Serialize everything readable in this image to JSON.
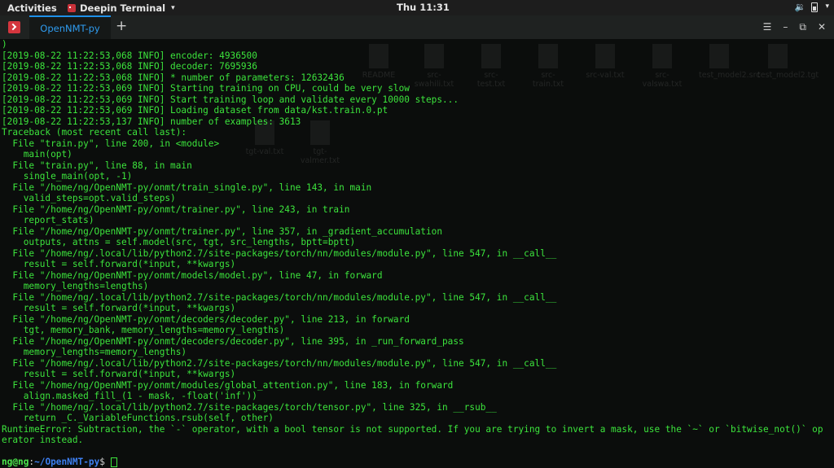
{
  "topbar": {
    "activities": "Activities",
    "app_name": "Deepin Terminal",
    "clock": "Thu 11:31"
  },
  "terminal": {
    "tab_label": "OpenNMT-py",
    "new_tab": "+",
    "lines": [
      ")",
      "[2019-08-22 11:22:53,068 INFO] encoder: 4936500",
      "[2019-08-22 11:22:53,068 INFO] decoder: 7695936",
      "[2019-08-22 11:22:53,068 INFO] * number of parameters: 12632436",
      "[2019-08-22 11:22:53,069 INFO] Starting training on CPU, could be very slow",
      "[2019-08-22 11:22:53,069 INFO] Start training loop and validate every 10000 steps...",
      "[2019-08-22 11:22:53,069 INFO] Loading dataset from data/kst.train.0.pt",
      "[2019-08-22 11:22:53,137 INFO] number of examples: 3613",
      "Traceback (most recent call last):",
      "  File \"train.py\", line 200, in <module>",
      "    main(opt)",
      "  File \"train.py\", line 88, in main",
      "    single_main(opt, -1)",
      "  File \"/home/ng/OpenNMT-py/onmt/train_single.py\", line 143, in main",
      "    valid_steps=opt.valid_steps)",
      "  File \"/home/ng/OpenNMT-py/onmt/trainer.py\", line 243, in train",
      "    report_stats)",
      "  File \"/home/ng/OpenNMT-py/onmt/trainer.py\", line 357, in _gradient_accumulation",
      "    outputs, attns = self.model(src, tgt, src_lengths, bptt=bptt)",
      "  File \"/home/ng/.local/lib/python2.7/site-packages/torch/nn/modules/module.py\", line 547, in __call__",
      "    result = self.forward(*input, **kwargs)",
      "  File \"/home/ng/OpenNMT-py/onmt/models/model.py\", line 47, in forward",
      "    memory_lengths=lengths)",
      "  File \"/home/ng/.local/lib/python2.7/site-packages/torch/nn/modules/module.py\", line 547, in __call__",
      "    result = self.forward(*input, **kwargs)",
      "  File \"/home/ng/OpenNMT-py/onmt/decoders/decoder.py\", line 213, in forward",
      "    tgt, memory_bank, memory_lengths=memory_lengths)",
      "  File \"/home/ng/OpenNMT-py/onmt/decoders/decoder.py\", line 395, in _run_forward_pass",
      "    memory_lengths=memory_lengths)",
      "  File \"/home/ng/.local/lib/python2.7/site-packages/torch/nn/modules/module.py\", line 547, in __call__",
      "    result = self.forward(*input, **kwargs)",
      "  File \"/home/ng/OpenNMT-py/onmt/modules/global_attention.py\", line 183, in forward",
      "    align.masked_fill_(1 - mask, -float('inf'))",
      "  File \"/home/ng/.local/lib/python2.7/site-packages/torch/tensor.py\", line 325, in __rsub__",
      "    return _C._VariableFunctions.rsub(self, other)",
      "RuntimeError: Subtraction, the `-` operator, with a bool tensor is not supported. If you are trying to invert a mask, use the `~` or `bitwise_not()` op",
      "erator instead."
    ],
    "prompt": {
      "user": "ng@ng",
      "sep": ":",
      "path": "~/OpenNMT-py",
      "symbol": "$ "
    }
  },
  "desktop_files": [
    {
      "name": "README"
    },
    {
      "name": "src-swahili.txt"
    },
    {
      "name": "src-test.txt"
    },
    {
      "name": "src-train.txt"
    },
    {
      "name": "src-val.txt"
    },
    {
      "name": "src-valswa.txt"
    },
    {
      "name": "test_model2.src"
    },
    {
      "name": "test_model2.tgt"
    },
    {
      "name": "tgt-val.txt"
    },
    {
      "name": "tgt-valmer.txt"
    }
  ],
  "colors": {
    "terminal_text": "#3ce43c",
    "tab_accent": "#1e90e8",
    "prompt_path": "#3d7ff0"
  }
}
